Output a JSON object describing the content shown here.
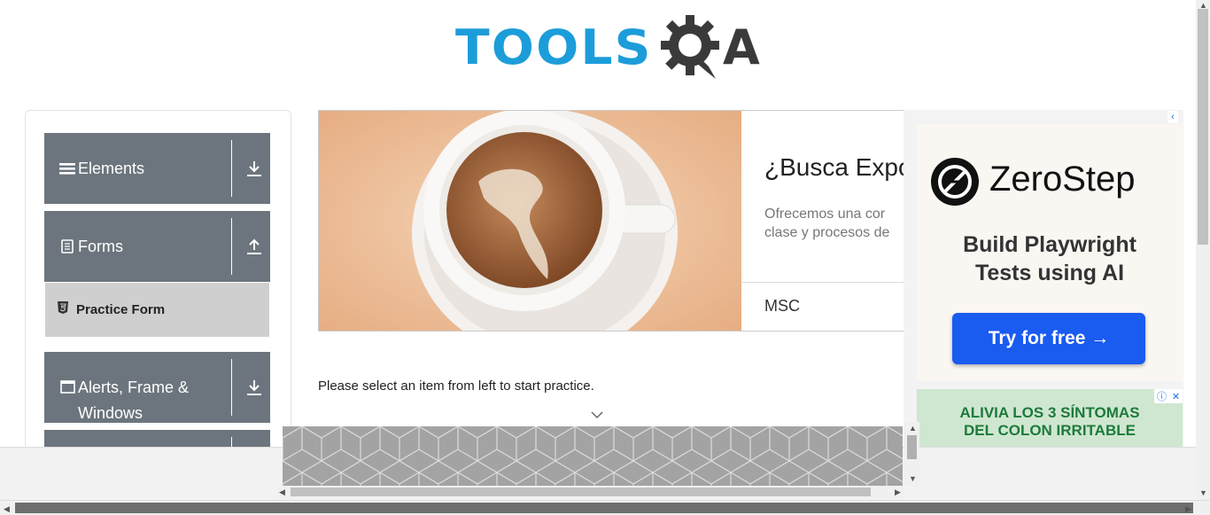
{
  "header": {
    "logo_text_1": "TOOLS",
    "logo_text_2": "QA"
  },
  "sidebar": {
    "groups": [
      {
        "label": "Elements",
        "icon": "hamburger-icon",
        "arrow": "download-icon"
      },
      {
        "label": "Forms",
        "icon": "document-icon",
        "arrow": "upload-icon"
      },
      {
        "label": "Alerts, Frame & Windows",
        "icon": "window-icon",
        "arrow": "download-icon"
      }
    ],
    "sub_items": [
      {
        "label": "Practice Form",
        "icon": "html5-icon"
      }
    ]
  },
  "main": {
    "banner": {
      "title": "¿Busca Expo",
      "desc_line1": "Ofrecemos una cor",
      "desc_line2": "clase y procesos de",
      "brand": "MSC"
    },
    "practice_text": "Please select an item from left to start practice."
  },
  "right_ad": {
    "brand": "ZeroStep",
    "tagline_line1": "Build Playwright",
    "tagline_line2": "Tests using AI",
    "button": "Try for free →",
    "colon_line1": "ALIVIA LOS 3  SÍNTOMAS",
    "colon_line2": "DEL COLON IRRITABLE"
  },
  "colors": {
    "brand_blue": "#1c9dd9",
    "sidebar_group": "#6c757d",
    "sub_item_bg": "#cfcfcf",
    "ad_button": "#1a5bf0"
  }
}
